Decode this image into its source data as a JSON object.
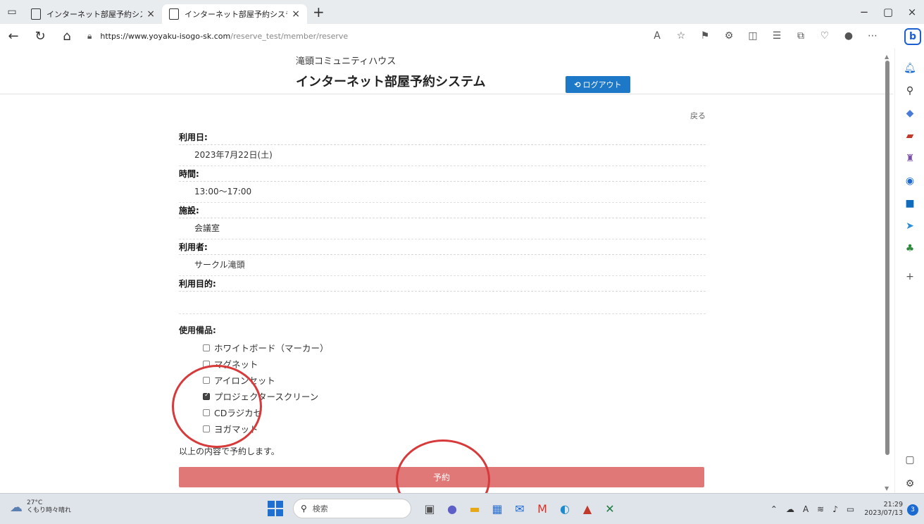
{
  "browser": {
    "tabs": [
      {
        "label": "インターネット部屋予約システム",
        "close": "×"
      },
      {
        "label": "インターネット部屋予約システム",
        "close": "×"
      }
    ],
    "new_tab": "+",
    "window_controls": {
      "minimize": "−",
      "restore": "▢",
      "close": "×"
    },
    "url_host": "https://www.yoyaku-isogo-sk.com",
    "url_path": "/reserve_test/member/reserve",
    "bing_label": "b"
  },
  "header": {
    "subtitle": "滝頭コミュニティハウス",
    "title": "インターネット部屋予約システム",
    "logout_label": "ログアウト"
  },
  "form": {
    "back_label": "戻る",
    "fields": [
      {
        "label": "利用日:",
        "value": "2023年7月22日(土)"
      },
      {
        "label": "時間:",
        "value": "13:00～17:00"
      },
      {
        "label": "施設:",
        "value": "会議室"
      },
      {
        "label": "利用者:",
        "value": "サークル滝頭"
      },
      {
        "label": "利用目的:",
        "value": ""
      }
    ],
    "equipment_label": "使用備品:",
    "equipment": [
      {
        "label": "ホワイトボード（マーカー）",
        "checked": false
      },
      {
        "label": "マグネット",
        "checked": false
      },
      {
        "label": "アイロンセット",
        "checked": false
      },
      {
        "label": "プロジェクタースクリーン",
        "checked": true
      },
      {
        "label": "CDラジカセ",
        "checked": false
      },
      {
        "label": "ヨガマット",
        "checked": false
      }
    ],
    "confirm_text": "以上の内容で予約します。",
    "submit_label": "予約"
  },
  "taskbar": {
    "temperature": "27°C",
    "weather": "くもり時々晴れ",
    "search_placeholder": "検索",
    "time": "21:29",
    "date": "2023/07/13",
    "notification_count": "3",
    "ime": "A"
  },
  "colors": {
    "logout_button": "#1e78c8",
    "submit_button": "#e07878",
    "annotation_circle": "#d63a3a"
  }
}
